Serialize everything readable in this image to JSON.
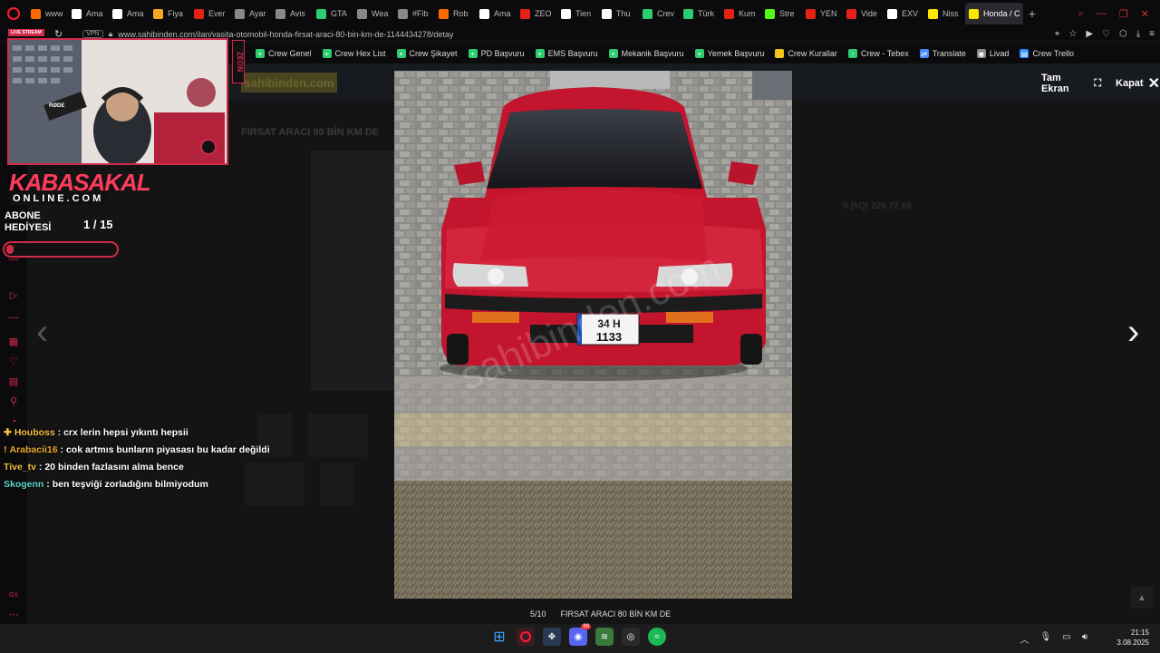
{
  "browser": {
    "tabs": [
      {
        "label": "www",
        "color": "#ff6a00"
      },
      {
        "label": "Ama",
        "color": "#ffffff"
      },
      {
        "label": "Ama",
        "color": "#ffffff"
      },
      {
        "label": "Fiya",
        "color": "#f5a623"
      },
      {
        "label": "Ever",
        "color": "#e62117"
      },
      {
        "label": "Ayar",
        "color": "#888888"
      },
      {
        "label": "Avis",
        "color": "#888888"
      },
      {
        "label": "GTA",
        "color": "#2ecc71"
      },
      {
        "label": "Wea",
        "color": "#888888"
      },
      {
        "label": "#Fib",
        "color": "#888888"
      },
      {
        "label": "Rob",
        "color": "#ff6a00"
      },
      {
        "label": "Ama",
        "color": "#ffffff"
      },
      {
        "label": "ZEO",
        "color": "#e62117"
      },
      {
        "label": "Tien",
        "color": "#ffffff"
      },
      {
        "label": "Thu",
        "color": "#ffffff"
      },
      {
        "label": "Crev",
        "color": "#2ecc71"
      },
      {
        "label": "Türk",
        "color": "#2ecc71"
      },
      {
        "label": "Kum",
        "color": "#e62117"
      },
      {
        "label": "Stre",
        "color": "#53fc18"
      },
      {
        "label": "YEN",
        "color": "#e62117"
      },
      {
        "label": "Vide",
        "color": "#e62117"
      },
      {
        "label": "EXV",
        "color": "#ffffff"
      },
      {
        "label": "Niss",
        "color": "#ffe800"
      }
    ],
    "active_tab": {
      "label": "Honda / C",
      "color": "#ffe800"
    },
    "url": "www.sahibinden.com/ilan/vasita-otomobil-honda-firsat-araci-80-bin-km-de-1144434278/detay",
    "vpn_label": "VPN",
    "live_badge": "LIVE STREAM"
  },
  "bookmarks": [
    {
      "label": "Crew Genel",
      "color": "#2ecc71",
      "icon": "+"
    },
    {
      "label": "Crew Hex List",
      "color": "#2ecc71",
      "icon": "+"
    },
    {
      "label": "Crew Şikayet",
      "color": "#2ecc71",
      "icon": "+"
    },
    {
      "label": "PD Başvuru",
      "color": "#2ecc71",
      "icon": "+"
    },
    {
      "label": "EMS Başvuru",
      "color": "#2ecc71",
      "icon": "+"
    },
    {
      "label": "Mekanik Başvuru",
      "color": "#2ecc71",
      "icon": "+"
    },
    {
      "label": "Yemek Başvuru",
      "color": "#2ecc71",
      "icon": "+"
    },
    {
      "label": "Crew Kurallar",
      "color": "#f5c518",
      "icon": ""
    },
    {
      "label": "Crew - Tebex",
      "color": "#2ecc71",
      "icon": "↑"
    },
    {
      "label": "Translate",
      "color": "#4a8cff",
      "icon": "⇄"
    },
    {
      "label": "Livad",
      "color": "#888888",
      "icon": "◉"
    },
    {
      "label": "Crew Trello",
      "color": "#2d8cff",
      "icon": "▤"
    }
  ],
  "page": {
    "logo": "sahibinden.com",
    "listing_title": "FIRSAT ARACI 80 BİN KM DE",
    "phone": "0 (5Q) 226 72 69"
  },
  "lightbox": {
    "fullscreen_label": "Tam Ekran",
    "close_label": "Kapat",
    "counter": "5/10",
    "caption": "FIRSAT ARACI 80 BİN KM DE",
    "plate_line1": "34 H",
    "plate_line2": "1133",
    "watermark": "sahibinden.com"
  },
  "overlay": {
    "brand_top": "KABASAKAL",
    "brand_bottom": "ONLINE.COM",
    "goal_label_1": "ABONE",
    "goal_label_2": "HEDİYESİ",
    "goal_count": "1 / 15",
    "goal_progress": 0.067,
    "mic_label": "RØDE",
    "zeon_label": "ZEON",
    "accent": "#d12b4a"
  },
  "chat": [
    {
      "user": "Houboss",
      "color": "#f0c040",
      "text": "crx lerin hepsi yıkıntı hepsii",
      "icon": "✚"
    },
    {
      "user": "Arabacii16",
      "color": "#e8a830",
      "text": "cok artmıs bunların piyasası bu kadar değildi",
      "icon": "!"
    },
    {
      "user": "Tive_tv",
      "color": "#f0c040",
      "text": "20 binden fazlasını alma bence",
      "icon": ""
    },
    {
      "user": "Skogenn",
      "color": "#5fd3c9",
      "text": "ben teşviği zorladığını bilmiyodum",
      "icon": ""
    }
  ],
  "taskbar": {
    "time": "21:15",
    "date": "3.08.2025",
    "discord_badge": "99"
  }
}
